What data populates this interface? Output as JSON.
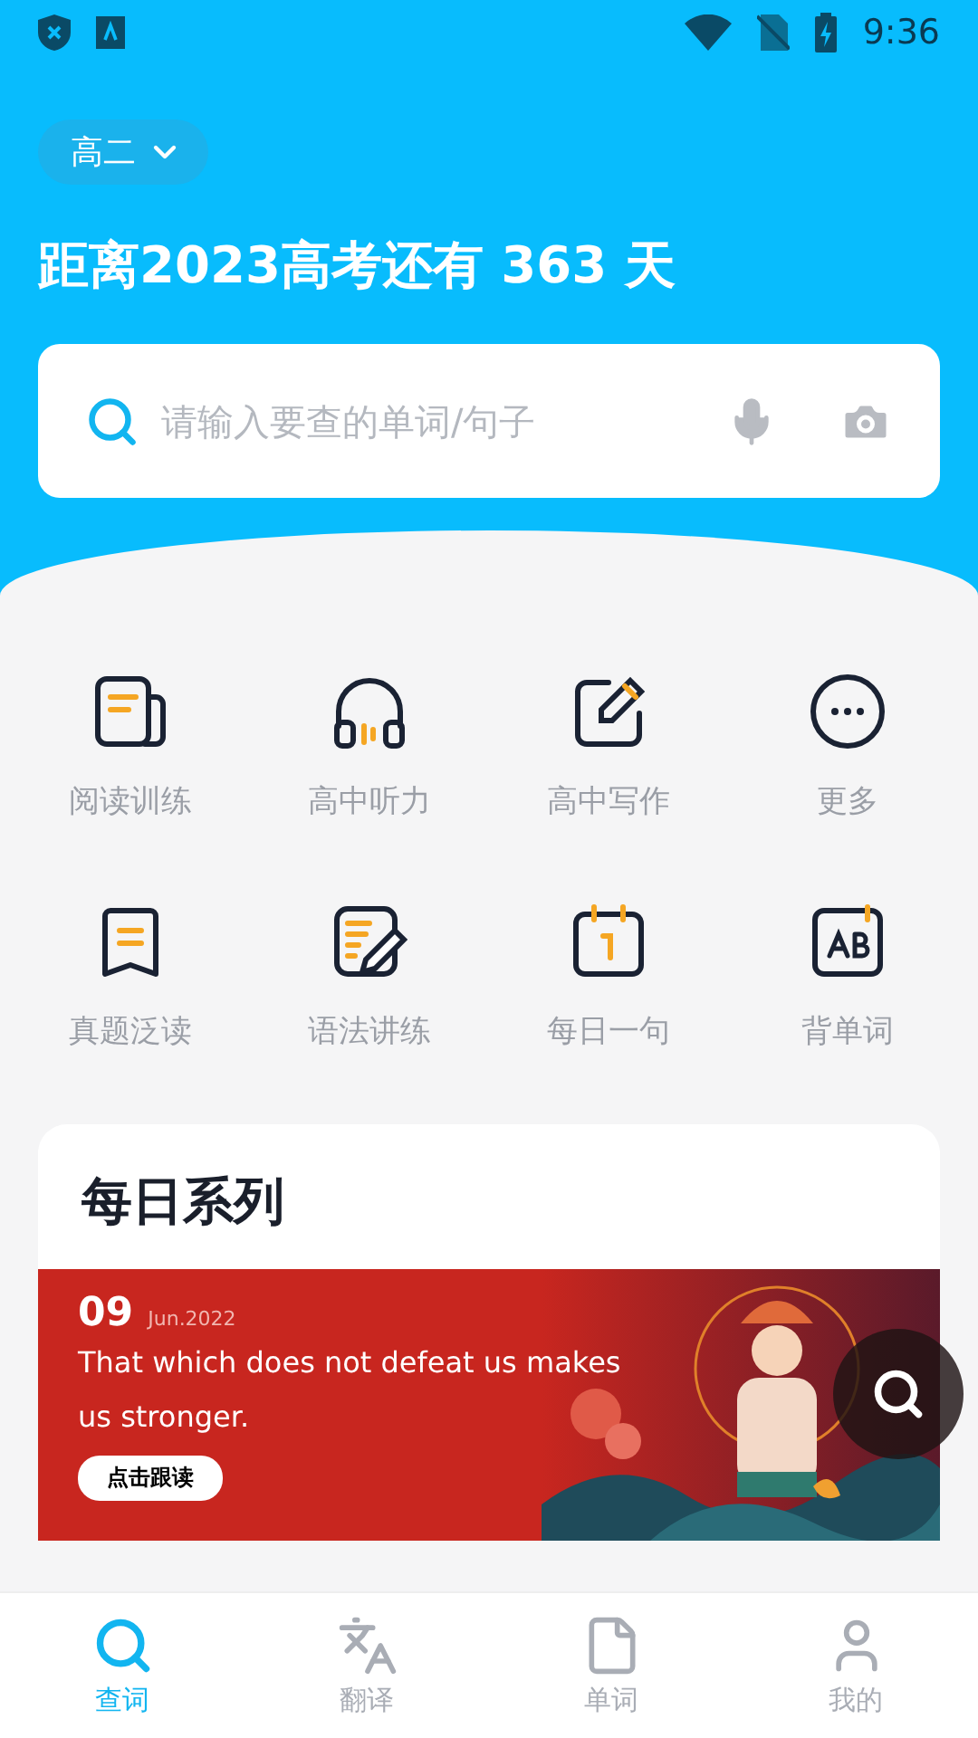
{
  "status_bar": {
    "time": "9:36"
  },
  "header": {
    "grade": "高二",
    "countdown": "距离2023高考还有 363 天"
  },
  "search": {
    "placeholder": "请输入要查的单词/句子"
  },
  "features": [
    {
      "label": "阅读训练"
    },
    {
      "label": "高中听力"
    },
    {
      "label": "高中写作"
    },
    {
      "label": "更多"
    },
    {
      "label": "真题泛读"
    },
    {
      "label": "语法讲练"
    },
    {
      "label": "每日一句"
    },
    {
      "label": "背单词"
    }
  ],
  "daily": {
    "title": "每日系列",
    "day": "09",
    "month_year": "Jun.2022",
    "quote": "That which does not defeat us makes us stronger.",
    "button": "点击跟读"
  },
  "nav": [
    {
      "label": "查词",
      "selected": true
    },
    {
      "label": "翻译",
      "selected": false
    },
    {
      "label": "单词",
      "selected": false
    },
    {
      "label": "我的",
      "selected": false
    }
  ]
}
